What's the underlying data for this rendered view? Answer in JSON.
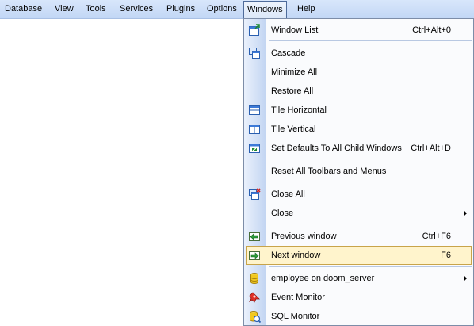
{
  "menubar": {
    "items": [
      {
        "label": "Database"
      },
      {
        "label": "View"
      },
      {
        "label": "Tools"
      },
      {
        "label": "Services"
      },
      {
        "label": "Plugins"
      },
      {
        "label": "Options"
      },
      {
        "label": "Windows"
      },
      {
        "label": "Help"
      }
    ],
    "active": "Windows"
  },
  "windows_menu": {
    "items": [
      {
        "label": "Window List",
        "shortcut": "Ctrl+Alt+0",
        "icon": "window-list-icon"
      },
      {
        "label": "Cascade",
        "icon": "cascade-icon"
      },
      {
        "label": "Minimize All"
      },
      {
        "label": "Restore All"
      },
      {
        "label": "Tile Horizontal",
        "icon": "tile-horizontal-icon"
      },
      {
        "label": "Tile Vertical",
        "icon": "tile-vertical-icon"
      },
      {
        "label": "Set Defaults To All Child Windows",
        "shortcut": "Ctrl+Alt+D",
        "icon": "set-defaults-icon"
      },
      {
        "label": "Reset All Toolbars and Menus"
      },
      {
        "label": "Close All",
        "icon": "close-all-icon"
      },
      {
        "label": "Close",
        "submenu": true
      },
      {
        "label": "Previous window",
        "shortcut": "Ctrl+F6",
        "icon": "previous-window-icon"
      },
      {
        "label": "Next window",
        "shortcut": "F6",
        "icon": "next-window-icon",
        "highlighted": true
      },
      {
        "label": "employee on doom_server",
        "submenu": true,
        "icon": "database-icon"
      },
      {
        "label": "Event Monitor",
        "icon": "event-monitor-icon"
      },
      {
        "label": "SQL Monitor",
        "icon": "sql-monitor-icon"
      }
    ]
  },
  "colors": {
    "menubar_top": "#d8e6fb",
    "menubar_bottom": "#c2d7f5",
    "highlight_fill": "#fff4cc",
    "highlight_border": "#c8a44a"
  }
}
